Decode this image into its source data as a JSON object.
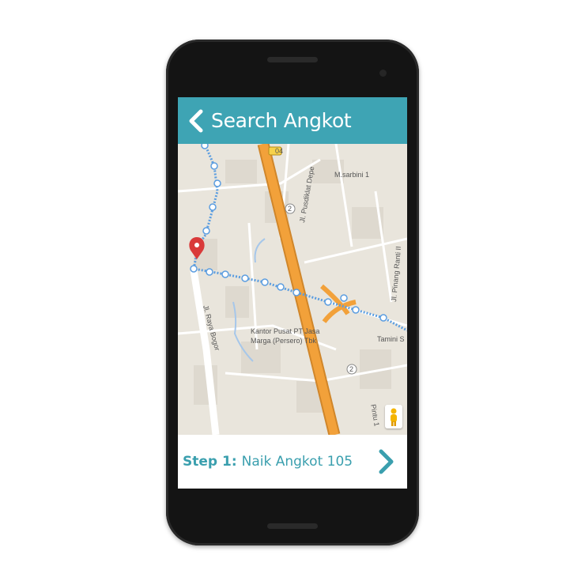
{
  "appbar": {
    "title": "Search Angkot",
    "back_icon": "chevron-left-icon"
  },
  "map": {
    "labels": {
      "road_code": "04",
      "street_sarbini": "M.sarbini 1",
      "street_pusdiklat": "Jl. Pusdiklat Depe",
      "street_pinang": "Jl. Pinang Ranti II",
      "street_raya_bogor": "Jl. Raya Bogor",
      "poi_line1": "Kantor Pusat PT Jasa",
      "poi_line2": "Marga (Persero) Tbk",
      "poi_tamini": "Tamini S",
      "street_pintu": "Pintu 1",
      "route_badge_1": "2",
      "route_badge_2": "2"
    },
    "pin_icon": "location-pin-icon",
    "pegman_icon": "pegman-icon"
  },
  "step": {
    "label": "Step 1:",
    "text": "Naik Angkot 105",
    "next_icon": "chevron-right-icon"
  },
  "colors": {
    "accent": "#3ea4b4",
    "highway": "#f2a13a",
    "route": "#5b9de0",
    "pin": "#d93a3a"
  }
}
